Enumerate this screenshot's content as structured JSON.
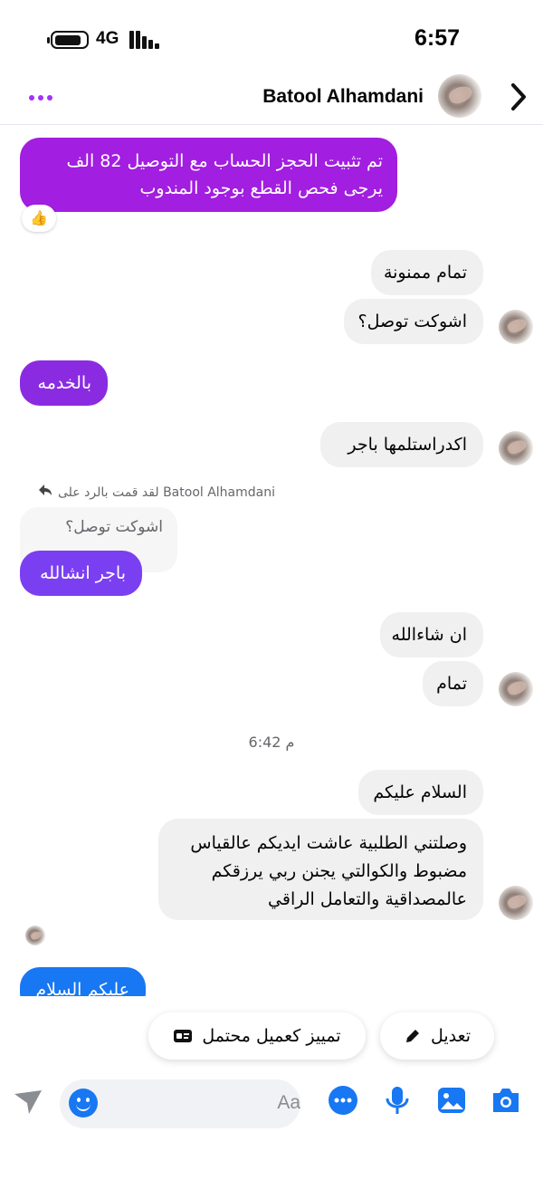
{
  "status_bar": {
    "network": "4G",
    "time": "6:57"
  },
  "header": {
    "contact_name": "Batool Alhamdani"
  },
  "colors": {
    "accent_purple": "#a033ff",
    "outgoing_violet": "#8a2be2",
    "outgoing_blue": "#1877f2",
    "incoming_bg": "#f0f0f0"
  },
  "messages": {
    "m1": "تم تثبيت الحجز الحساب مع التوصيل 82 الف\nيرجى فحص القطع بوجود المندوب",
    "m1_reaction": "👍",
    "m2": "تمام ممنونة",
    "m3": "اشوكت توصل؟",
    "m4": "بالخدمه",
    "m5": "اكدراستلمها باجر",
    "reply_note": "لقد قمت بالرد على Batool Alhamdani",
    "quoted": "اشوكت توصل؟",
    "m6": "باجر انشالله",
    "m7": "ان شاءالله",
    "m8": "تمام",
    "timestamp": "6:42 م",
    "m9": "السلام عليكم",
    "m10": "وصلتني الطلبية عاشت ايديكم عالقياس\nمضبوط والكوالتي يجنن ربي يرزقكم\nعالمصداقية والتعامل الراقي",
    "m11": "عليكم السلام"
  },
  "actions": {
    "edit_label": "تعديل",
    "potential_client_label": "تمييز كعميل محتمل"
  },
  "composer": {
    "placeholder": "Aa"
  },
  "icons": {
    "more": "more-dots-icon",
    "back": "chevron-right-icon",
    "edit": "pencil-icon",
    "client": "id-card-icon",
    "expand": "arrow-expand-icon",
    "emoji": "emoji-icon",
    "menu": "chat-bubble-dots-icon",
    "mic": "microphone-icon",
    "gallery": "image-icon",
    "camera": "camera-icon"
  }
}
